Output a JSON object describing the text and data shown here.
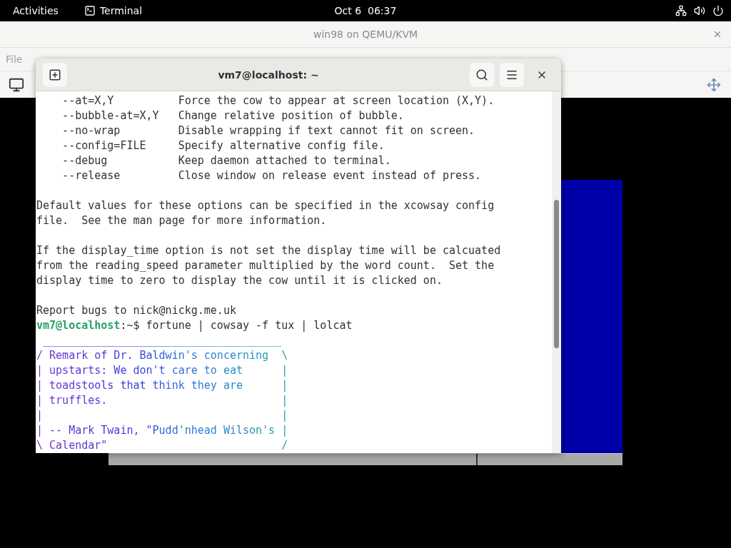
{
  "top_bar": {
    "activities": "Activities",
    "app_name": "Terminal",
    "clock": "Oct 6  06:37"
  },
  "vm_window": {
    "title": "win98 on QEMU/KVM",
    "menu": [
      "File"
    ]
  },
  "terminal": {
    "title": "vm7@localhost: ~",
    "lines": [
      {
        "kind": "text",
        "text": "    --at=X,Y          Force the cow to appear at screen location (X,Y)."
      },
      {
        "kind": "text",
        "text": "    --bubble-at=X,Y   Change relative position of bubble."
      },
      {
        "kind": "text",
        "text": "    --no-wrap         Disable wrapping if text cannot fit on screen."
      },
      {
        "kind": "text",
        "text": "    --config=FILE     Specify alternative config file."
      },
      {
        "kind": "text",
        "text": "    --debug           Keep daemon attached to terminal."
      },
      {
        "kind": "text",
        "text": "    --release         Close window on release event instead of press."
      },
      {
        "kind": "blank"
      },
      {
        "kind": "text",
        "text": "Default values for these options can be specified in the xcowsay config"
      },
      {
        "kind": "text",
        "text": "file.  See the man page for more information."
      },
      {
        "kind": "blank"
      },
      {
        "kind": "text",
        "text": "If the display_time option is not set the display time will be calcuated"
      },
      {
        "kind": "text",
        "text": "from the reading_speed parameter multiplied by the word count.  Set the"
      },
      {
        "kind": "text",
        "text": "display time to zero to display the cow until it is clicked on."
      },
      {
        "kind": "blank"
      },
      {
        "kind": "text",
        "text": "Report bugs to nick@nickg.me.uk"
      },
      {
        "kind": "prompt",
        "user_host": "vm7@localhost",
        "prompt": ":~$ ",
        "command": "fortune | cowsay -f tux | lolcat"
      },
      {
        "kind": "lolcat",
        "text": " _____________________________________"
      },
      {
        "kind": "lolcat",
        "text": "/ Remark of Dr. Baldwin's concerning  \\"
      },
      {
        "kind": "lolcat",
        "text": "| upstarts: We don't care to eat      |"
      },
      {
        "kind": "lolcat",
        "text": "| toadstools that think they are      |"
      },
      {
        "kind": "lolcat",
        "text": "| truffles.                           |"
      },
      {
        "kind": "lolcat",
        "text": "|                                     |"
      },
      {
        "kind": "lolcat",
        "text": "| -- Mark Twain, \"Pudd'nhead Wilson's |"
      },
      {
        "kind": "lolcat",
        "text": "\\ Calendar\"                           /"
      }
    ]
  }
}
